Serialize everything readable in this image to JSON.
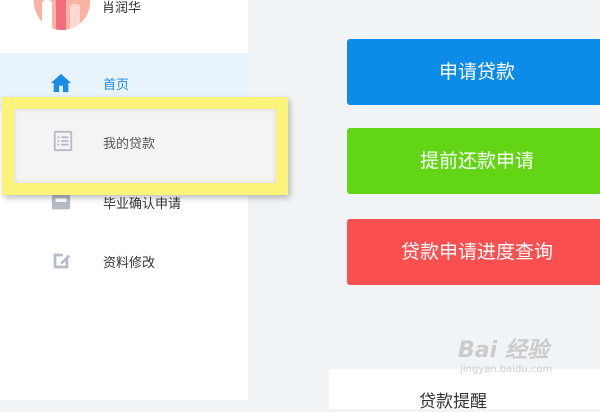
{
  "user": {
    "name": "肖润华"
  },
  "sidebar": {
    "items": [
      {
        "label": "首页",
        "icon": "home-icon",
        "active": true
      },
      {
        "label": "我的贷款",
        "icon": "list-icon",
        "highlighted": true
      },
      {
        "label": "毕业确认申请",
        "icon": "inbox-icon"
      },
      {
        "label": "资料修改",
        "icon": "edit-icon"
      }
    ]
  },
  "actions": {
    "apply_label": "申请贷款",
    "early_repay_label": "提前还款申请",
    "progress_label": "贷款申请进度查询"
  },
  "reminder": {
    "title": "贷款提醒"
  },
  "watermark": {
    "main": "Bai 经验",
    "sub": "jingyan.baidu.com"
  },
  "colors": {
    "accent_blue": "#0d8be8",
    "green": "#62d614",
    "red": "#fc4f4f",
    "highlight_yellow": "#fbf37a"
  }
}
